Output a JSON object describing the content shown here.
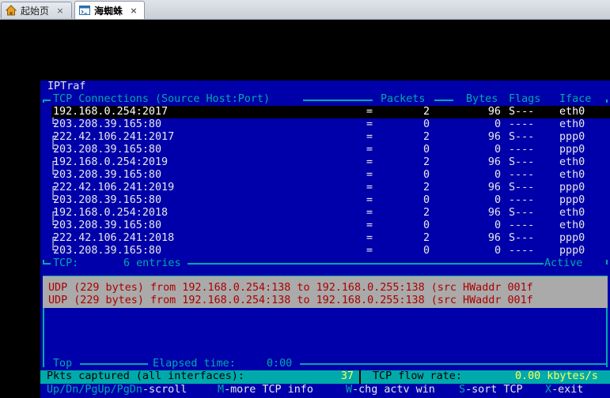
{
  "browser": {
    "tabs": [
      {
        "label": "起始页",
        "icon": "home-icon",
        "active": false
      },
      {
        "label": "海蜘蛛",
        "icon": "terminal-page-icon",
        "active": true
      }
    ],
    "close_symbol": "×"
  },
  "iptraf": {
    "title": "IPTraf",
    "header": {
      "conn_label": "TCP Connections (Source Host:Port)",
      "packets": "Packets",
      "bytes": "Bytes",
      "flags": "Flags",
      "iface": "Iface"
    },
    "connections": [
      {
        "host": "192.168.0.254:2017",
        "eq": "=",
        "packets": "2",
        "bytes": "96",
        "flags": "S---",
        "iface": "eth0"
      },
      {
        "host": "203.208.39.165:80",
        "eq": "=",
        "packets": "0",
        "bytes": "0",
        "flags": "----",
        "iface": "eth0"
      },
      {
        "host": "222.42.106.241:2017",
        "eq": "=",
        "packets": "2",
        "bytes": "96",
        "flags": "S---",
        "iface": "ppp0"
      },
      {
        "host": "203.208.39.165:80",
        "eq": "=",
        "packets": "0",
        "bytes": "0",
        "flags": "----",
        "iface": "ppp0"
      },
      {
        "host": "192.168.0.254:2019",
        "eq": "=",
        "packets": "2",
        "bytes": "96",
        "flags": "S---",
        "iface": "eth0"
      },
      {
        "host": "203.208.39.165:80",
        "eq": "=",
        "packets": "0",
        "bytes": "0",
        "flags": "----",
        "iface": "eth0"
      },
      {
        "host": "222.42.106.241:2019",
        "eq": "=",
        "packets": "2",
        "bytes": "96",
        "flags": "S---",
        "iface": "ppp0"
      },
      {
        "host": "203.208.39.165:80",
        "eq": "=",
        "packets": "0",
        "bytes": "0",
        "flags": "----",
        "iface": "ppp0"
      },
      {
        "host": "192.168.0.254:2018",
        "eq": "=",
        "packets": "2",
        "bytes": "96",
        "flags": "S---",
        "iface": "eth0"
      },
      {
        "host": "203.208.39.165:80",
        "eq": "=",
        "packets": "0",
        "bytes": "0",
        "flags": "----",
        "iface": "eth0"
      },
      {
        "host": "222.42.106.241:2018",
        "eq": "=",
        "packets": "2",
        "bytes": "96",
        "flags": "S---",
        "iface": "ppp0"
      },
      {
        "host": "203.208.39.165:80",
        "eq": "=",
        "packets": "0",
        "bytes": "0",
        "flags": "----",
        "iface": "ppp0"
      }
    ],
    "tcp_footer": {
      "label": "TCP:",
      "entries": "6 entries",
      "state": "Active"
    },
    "udp_lines": [
      "UDP (229 bytes) from 192.168.0.254:138 to 192.168.0.255:138 (src HWaddr 001f",
      "UDP (229 bytes) from 192.168.0.254:138 to 192.168.0.255:138 (src HWaddr 001f"
    ],
    "bottom": {
      "top_label": "Top",
      "elapsed_label": "Elapsed time:",
      "elapsed_value": "0:00"
    },
    "status": {
      "pkts_label": "Pkts captured (all interfaces):",
      "pkts_value": "37",
      "flow_label": "TCP flow rate:",
      "flow_value": "0.00 kbytes/s"
    },
    "keys": [
      {
        "key": "Up/Dn/PgUp/PgDn",
        "action": "-scroll"
      },
      {
        "key": "M",
        "action": "-more TCP info"
      },
      {
        "key": "W",
        "action": "-chg actv win"
      },
      {
        "key": "S",
        "action": "-sort TCP"
      },
      {
        "key": "X",
        "action": "-exit"
      }
    ],
    "colors": {
      "background": "#0000aa",
      "border": "#00aaaa",
      "highlight": "#000000",
      "udp_panel": "#aaaaaa",
      "udp_text": "#aa0000"
    }
  }
}
